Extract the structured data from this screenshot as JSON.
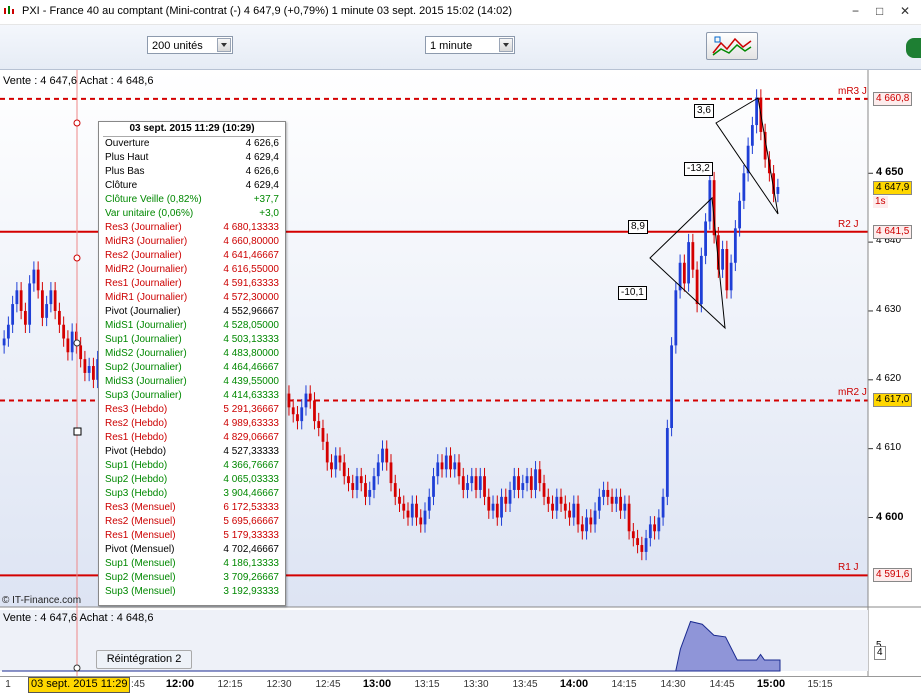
{
  "window": {
    "title": "PXI - France 40 au comptant (Mini-contrat  (-)   4 647,9 (+0,79%)     1 minute  03 sept. 2015 15:02 (14:02)",
    "min": "−",
    "max": "□",
    "close": "✕"
  },
  "toolbar": {
    "units_select": "200 unités",
    "period_select": "1 minute",
    "tool_icon": "chart-tools-icon"
  },
  "info": {
    "top": "Vente : 4 647,6  Achat : 4 648,6",
    "sub": "Vente : 4 647,6  Achat : 4 648,6",
    "copyright": "© IT-Finance.com",
    "reintegration_label": "Réintégration",
    "reintegration_value": "2"
  },
  "tooltip": {
    "title": "03 sept. 2015 11:29 (10:29)",
    "rows": [
      {
        "label": "Ouverture",
        "value": "4 626,6",
        "color": "black"
      },
      {
        "label": "Plus Haut",
        "value": "4 629,4",
        "color": "black"
      },
      {
        "label": "Plus Bas",
        "value": "4 626,6",
        "color": "black"
      },
      {
        "label": "Clôture",
        "value": "4 629,4",
        "color": "black"
      },
      {
        "label": "Clôture Veille (0,82%)",
        "value": "+37,7",
        "color": "green"
      },
      {
        "label": "Var unitaire (0,06%)",
        "value": "+3,0",
        "color": "green"
      },
      {
        "label": "Res3 (Journalier)",
        "value": "4 680,13333",
        "color": "red"
      },
      {
        "label": "MidR3 (Journalier)",
        "value": "4 660,80000",
        "color": "red"
      },
      {
        "label": "Res2 (Journalier)",
        "value": "4 641,46667",
        "color": "red"
      },
      {
        "label": "MidR2 (Journalier)",
        "value": "4 616,55000",
        "color": "red"
      },
      {
        "label": "Res1 (Journalier)",
        "value": "4 591,63333",
        "color": "red"
      },
      {
        "label": "MidR1 (Journalier)",
        "value": "4 572,30000",
        "color": "red"
      },
      {
        "label": "Pivot (Journalier)",
        "value": "4 552,96667",
        "color": "black"
      },
      {
        "label": "MidS1 (Journalier)",
        "value": "4 528,05000",
        "color": "green"
      },
      {
        "label": "Sup1 (Journalier)",
        "value": "4 503,13333",
        "color": "green"
      },
      {
        "label": "MidS2 (Journalier)",
        "value": "4 483,80000",
        "color": "green"
      },
      {
        "label": "Sup2 (Journalier)",
        "value": "4 464,46667",
        "color": "green"
      },
      {
        "label": "MidS3 (Journalier)",
        "value": "4 439,55000",
        "color": "green"
      },
      {
        "label": "Sup3 (Journalier)",
        "value": "4 414,63333",
        "color": "green"
      },
      {
        "label": "Res3 (Hebdo)",
        "value": "5 291,36667",
        "color": "red"
      },
      {
        "label": "Res2 (Hebdo)",
        "value": "4 989,63333",
        "color": "red"
      },
      {
        "label": "Res1 (Hebdo)",
        "value": "4 829,06667",
        "color": "red"
      },
      {
        "label": "Pivot (Hebdo)",
        "value": "4 527,33333",
        "color": "black"
      },
      {
        "label": "Sup1 (Hebdo)",
        "value": "4 366,76667",
        "color": "green"
      },
      {
        "label": "Sup2 (Hebdo)",
        "value": "4 065,03333",
        "color": "green"
      },
      {
        "label": "Sup3 (Hebdo)",
        "value": "3 904,46667",
        "color": "green"
      },
      {
        "label": "Res3 (Mensuel)",
        "value": "6 172,53333",
        "color": "red"
      },
      {
        "label": "Res2 (Mensuel)",
        "value": "5 695,66667",
        "color": "red"
      },
      {
        "label": "Res1 (Mensuel)",
        "value": "5 179,33333",
        "color": "red"
      },
      {
        "label": "Pivot (Mensuel)",
        "value": "4 702,46667",
        "color": "black"
      },
      {
        "label": "Sup1 (Mensuel)",
        "value": "4 186,13333",
        "color": "green"
      },
      {
        "label": "Sup2 (Mensuel)",
        "value": "3 709,26667",
        "color": "green"
      },
      {
        "label": "Sup3 (Mensuel)",
        "value": "3 192,93333",
        "color": "green"
      }
    ]
  },
  "chart_data": {
    "type": "candlestick",
    "title": "PXI - France 40 au comptant (Mini-contrat)",
    "ylim": [
      4587,
      4665
    ],
    "yticks": [
      {
        "value": 4600,
        "label": "4 600",
        "bold": true
      },
      {
        "value": 4610,
        "label": "4 610",
        "bold": false
      },
      {
        "value": 4620,
        "label": "4 620",
        "bold": false
      },
      {
        "value": 4630,
        "label": "4 630",
        "bold": false
      },
      {
        "value": 4640,
        "label": "4 640",
        "bold": false
      },
      {
        "value": 4650,
        "label": "4 650",
        "bold": true
      }
    ],
    "xticks": [
      {
        "label": "1",
        "bold": false
      },
      {
        "label": ":45",
        "bold": false
      },
      {
        "label": "12:00",
        "bold": true
      },
      {
        "label": "12:15",
        "bold": false
      },
      {
        "label": "12:30",
        "bold": false
      },
      {
        "label": "12:45",
        "bold": false
      },
      {
        "label": "13:00",
        "bold": true
      },
      {
        "label": "13:15",
        "bold": false
      },
      {
        "label": "13:30",
        "bold": false
      },
      {
        "label": "13:45",
        "bold": false
      },
      {
        "label": "14:00",
        "bold": true
      },
      {
        "label": "14:15",
        "bold": false
      },
      {
        "label": "14:30",
        "bold": false
      },
      {
        "label": "14:45",
        "bold": false
      },
      {
        "label": "15:00",
        "bold": true
      },
      {
        "label": "15:15",
        "bold": false
      }
    ],
    "cursor_label": "03 sept. 2015 11:29",
    "levels": [
      {
        "name": "mR3 J",
        "value": 4660.8,
        "label": "4 660,8",
        "style": "dashed"
      },
      {
        "name": "R2 J",
        "value": 4641.5,
        "label": "4 641,5",
        "style": "solid"
      },
      {
        "name": "mR2 J",
        "value": 4617.0,
        "label": "4 617,0",
        "style": "dashed"
      },
      {
        "name": "R1 J",
        "value": 4591.6,
        "label": "4 591,6",
        "style": "solid"
      }
    ],
    "last_price": {
      "value": 4647.9,
      "label": "4 647,9",
      "timer": "1s"
    },
    "annotations": [
      "3,6",
      "-13,2",
      "8,9",
      "-10,1"
    ],
    "closes": [
      4626,
      4628,
      4631,
      4633,
      4630,
      4628,
      4634,
      4636,
      4633,
      4629,
      4631,
      4633,
      4630,
      4628,
      4626,
      4624,
      4627,
      4625,
      4623,
      4621,
      4622,
      4620,
      4623,
      4621,
      4619,
      4621,
      4620,
      4622,
      4618,
      4619,
      4620,
      4617,
      4618,
      4616,
      4617,
      4615,
      4617,
      4614,
      4615,
      4613,
      4612,
      4614,
      4616,
      4617,
      4615,
      4618,
      4616,
      4617,
      4615,
      4613,
      4614,
      4612,
      4611,
      4613,
      4614,
      4612,
      4614,
      4613,
      4610,
      4612,
      4614,
      4616,
      4618,
      4617,
      4619,
      4617,
      4618,
      4616,
      4615,
      4614,
      4616,
      4618,
      4617,
      4614,
      4613,
      4611,
      4608,
      4607,
      4609,
      4608,
      4606,
      4605,
      4604,
      4606,
      4605,
      4603,
      4604,
      4606,
      4608,
      4610,
      4608,
      4605,
      4603,
      4602,
      4601,
      4600,
      4602,
      4600,
      4599,
      4601,
      4603,
      4606,
      4608,
      4607,
      4609,
      4607,
      4608,
      4606,
      4604,
      4605,
      4606,
      4604,
      4606,
      4603,
      4601,
      4602,
      4600,
      4603,
      4602,
      4604,
      4606,
      4604,
      4605,
      4606,
      4604,
      4607,
      4605,
      4603,
      4602,
      4601,
      4603,
      4602,
      4601,
      4600,
      4602,
      4599,
      4598,
      4600,
      4599,
      4601,
      4603,
      4604,
      4603,
      4602,
      4603,
      4601,
      4602,
      4598,
      4597,
      4596,
      4595,
      4597,
      4599,
      4598,
      4600,
      4603,
      4613,
      4625,
      4633,
      4637,
      4634,
      4640,
      4636,
      4631,
      4638,
      4643,
      4649,
      4641,
      4636,
      4639,
      4633,
      4637,
      4642,
      4646,
      4650,
      4654,
      4657,
      4661,
      4656,
      4652,
      4650,
      4647,
      4648
    ]
  },
  "volume": {
    "values": [
      0,
      0,
      0,
      0,
      0,
      0,
      0,
      0,
      0,
      0,
      0,
      0,
      0,
      0,
      0,
      0,
      0,
      0,
      0,
      0,
      0,
      0,
      0,
      0,
      0,
      0,
      0,
      0,
      0,
      0,
      0,
      0,
      0,
      0,
      0,
      0,
      0,
      0,
      0,
      0,
      0,
      0,
      0,
      0,
      0,
      0,
      0,
      0,
      0,
      0,
      0,
      0,
      0,
      0,
      0,
      0,
      0,
      0,
      0,
      0,
      0,
      0,
      0,
      0,
      0,
      0,
      0,
      0,
      0,
      0,
      0,
      0,
      0,
      0,
      0,
      0,
      0,
      0,
      0,
      0,
      0,
      0,
      0,
      0,
      0,
      0,
      0,
      0,
      0,
      0,
      0,
      0,
      0,
      0,
      0,
      0,
      0,
      0,
      0,
      0,
      0,
      0,
      0,
      0,
      0,
      0,
      0,
      0,
      0,
      0,
      0,
      0,
      0,
      0,
      0,
      0,
      0,
      0,
      0,
      0,
      0,
      0,
      0,
      0,
      0,
      0,
      0,
      0,
      0,
      0,
      0,
      0,
      0,
      0,
      0,
      0,
      0,
      0,
      0,
      0,
      0,
      0,
      0,
      0,
      0,
      0,
      0,
      0,
      0,
      0,
      0,
      0,
      0,
      0,
      0,
      0,
      0,
      0,
      0,
      0,
      0,
      0,
      0,
      0,
      0,
      0,
      0,
      0,
      0,
      0,
      0,
      0,
      0,
      0,
      0,
      0,
      0,
      0,
      0,
      0,
      0,
      0,
      0,
      0,
      0,
      0,
      0,
      0,
      0,
      0,
      0,
      0,
      0,
      0,
      0,
      0,
      0,
      0,
      0,
      0,
      0,
      0,
      0,
      0,
      0,
      0,
      0,
      0,
      0,
      0,
      0,
      0,
      0,
      0,
      0,
      0,
      0,
      0,
      0,
      0,
      0,
      0,
      0,
      0,
      0,
      0,
      0,
      0,
      0,
      0,
      0,
      0,
      0,
      0,
      0,
      0,
      0,
      0,
      0,
      0,
      0,
      0,
      0,
      0,
      0,
      0,
      0,
      0,
      0,
      0,
      0
    ],
    "ylabel": "5",
    "last": "4"
  }
}
